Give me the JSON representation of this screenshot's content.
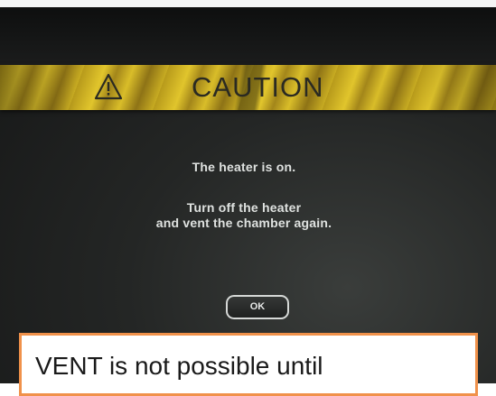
{
  "dialog": {
    "title": "CAUTION",
    "warning_icon": "warning-triangle-icon",
    "message_line_1": "The heater is on.",
    "message_line_2": "Turn off the heater",
    "message_line_3": "and vent the chamber again.",
    "ok_label": "OK"
  },
  "annotation": {
    "text": "VENT is not possible until",
    "border_color": "#f0914a"
  },
  "colors": {
    "caution_bar": "#d4b927",
    "screen_background": "#1f2120"
  }
}
